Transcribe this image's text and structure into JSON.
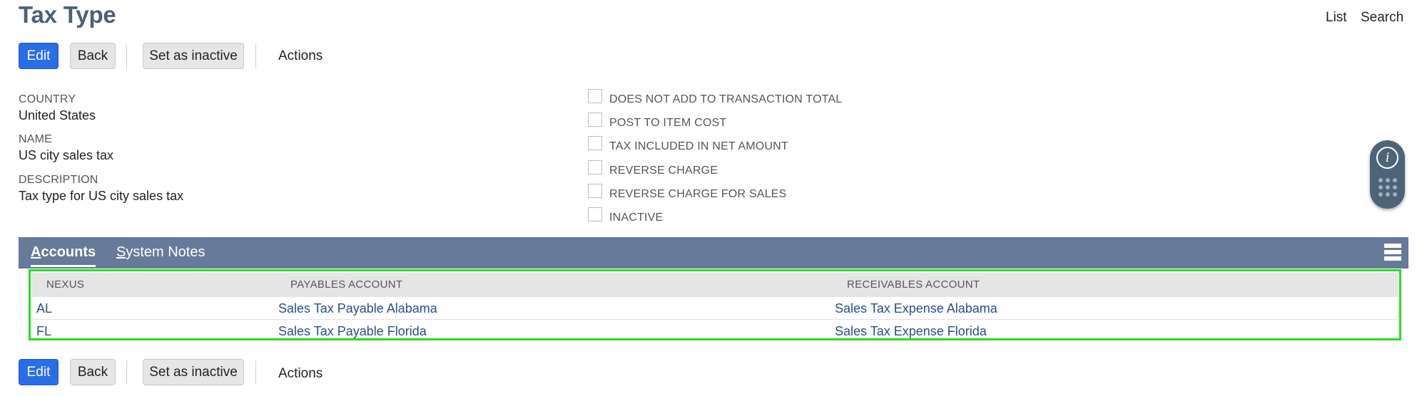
{
  "page": {
    "title": "Tax Type"
  },
  "top_nav": {
    "list": "List",
    "search": "Search"
  },
  "toolbar": {
    "edit": "Edit",
    "back": "Back",
    "set_inactive": "Set as inactive",
    "actions": "Actions"
  },
  "fields": [
    {
      "label": "COUNTRY",
      "value": "United States"
    },
    {
      "label": "NAME",
      "value": "US city sales tax"
    },
    {
      "label": "DESCRIPTION",
      "value": "Tax type for US city sales tax"
    }
  ],
  "checkboxes": [
    {
      "label": "DOES NOT ADD TO TRANSACTION TOTAL",
      "checked": false
    },
    {
      "label": "POST TO ITEM COST",
      "checked": false
    },
    {
      "label": "TAX INCLUDED IN NET AMOUNT",
      "checked": false
    },
    {
      "label": "REVERSE CHARGE",
      "checked": false
    },
    {
      "label": "REVERSE CHARGE FOR SALES",
      "checked": false
    },
    {
      "label": "INACTIVE",
      "checked": false
    }
  ],
  "tabs": [
    {
      "first": "A",
      "rest": "ccounts",
      "active": true
    },
    {
      "first": "S",
      "rest": "ystem Notes",
      "active": false
    }
  ],
  "table": {
    "headers": [
      "NEXUS",
      "PAYABLES ACCOUNT",
      "RECEIVABLES ACCOUNT"
    ],
    "rows": [
      [
        "AL",
        "Sales Tax Payable Alabama",
        "Sales Tax Expense Alabama"
      ],
      [
        "FL",
        "Sales Tax Payable Florida",
        "Sales Tax Expense Florida"
      ]
    ]
  },
  "icons": {
    "info": "i",
    "widget": "info-icon",
    "dots": "dots-grid-icon",
    "menu": "stacked-rows-icon"
  },
  "colors": {
    "primary": "#2a6de8",
    "tabbar": "#667a99",
    "title": "#4d5f79",
    "link": "#2b4e8a",
    "highlight": "#22e11f"
  }
}
